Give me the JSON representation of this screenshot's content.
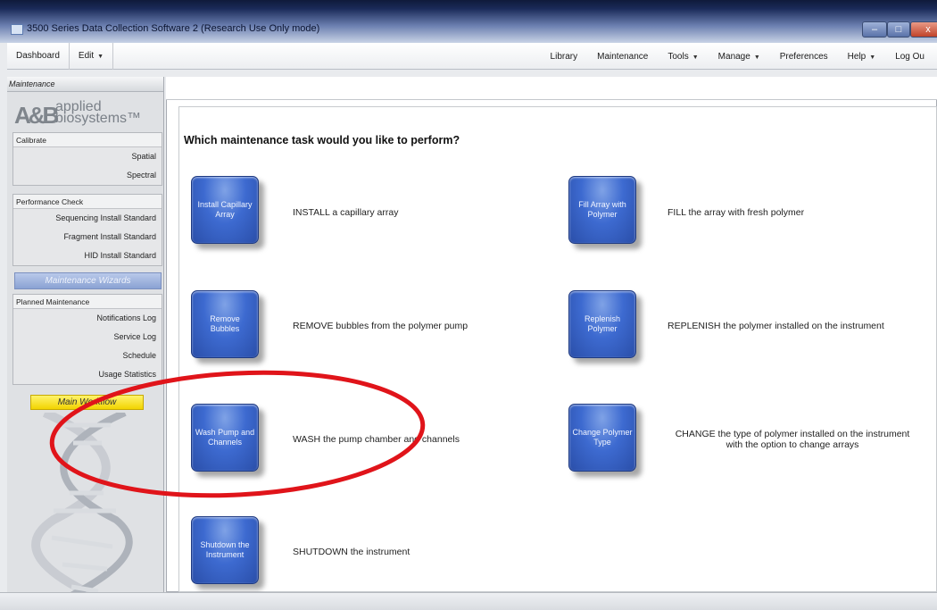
{
  "window": {
    "title": "3500 Series Data Collection Software 2 (Research Use Only mode)"
  },
  "menubar": {
    "dashboard": "Dashboard",
    "edit": "Edit",
    "library": "Library",
    "maintenance": "Maintenance",
    "tools": "Tools",
    "manage": "Manage",
    "preferences": "Preferences",
    "help": "Help",
    "logout": "Log Ou"
  },
  "sidebar": {
    "header": "Maintenance",
    "logo_line1": "applied",
    "logo_line2": "biosystems™",
    "calibrate": {
      "label": "Calibrate",
      "items": [
        "Spatial",
        "Spectral"
      ]
    },
    "performance_check": {
      "label": "Performance Check",
      "items": [
        "Sequencing Install Standard",
        "Fragment Install Standard",
        "HID Install Standard"
      ]
    },
    "maintenance_wizards": "Maintenance Wizards",
    "planned_maintenance": {
      "label": "Planned Maintenance",
      "items": [
        "Notifications Log",
        "Service Log",
        "Schedule",
        "Usage Statistics"
      ]
    },
    "main_workflow": "Main Workflow"
  },
  "main": {
    "question": "Which maintenance task would you like to perform?",
    "tasks": [
      {
        "button": "Install Capillary Array",
        "description": "INSTALL a capillary array"
      },
      {
        "button": "Fill Array with Polymer",
        "description": "FILL the array with fresh polymer"
      },
      {
        "button": "Remove Bubbles",
        "description": "REMOVE bubbles from the polymer pump"
      },
      {
        "button": "Replenish Polymer",
        "description": "REPLENISH the polymer installed on the instrument"
      },
      {
        "button": "Wash Pump and Channels",
        "description": "WASH the pump chamber and channels"
      },
      {
        "button": "Change Polymer Type",
        "description": "CHANGE the type of polymer installed on the instrument"
      },
      {
        "button": "Shutdown the Instrument",
        "description": "SHUTDOWN the instrument"
      }
    ],
    "change_polymer_desc_line2": "with the option to change arrays"
  },
  "annotation_color": "#e0141a"
}
